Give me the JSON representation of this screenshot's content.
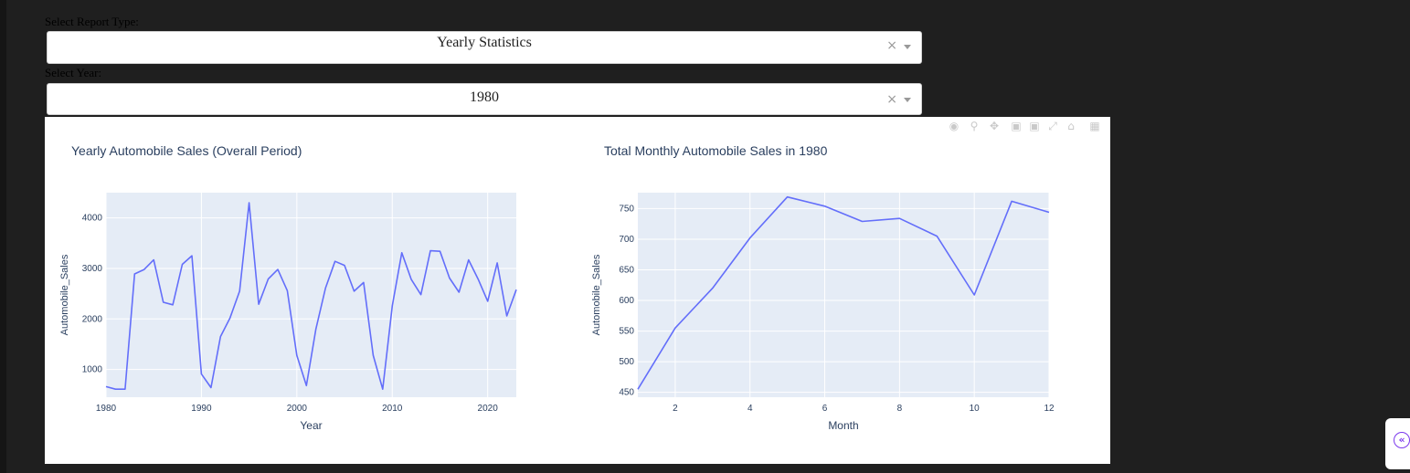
{
  "form": {
    "report_type_label": "Select Report Type:",
    "report_type_value": "Yearly Statistics",
    "year_label": "Select Year:",
    "year_value": "1980",
    "clear_glyph": "×"
  },
  "toolbar": {
    "icons": [
      "camera-icon",
      "zoom-icon",
      "pan-icon",
      "zoom-in-icon",
      "zoom-out-icon",
      "autoscale-icon",
      "reset-axes-icon",
      "plotly-logo-icon"
    ]
  },
  "colors": {
    "background": "#1f1f1f",
    "line": "#636efa",
    "plot_bg": "#e5ecf6",
    "text": "#2a3f5f"
  },
  "chart_data": [
    {
      "type": "line",
      "title": "Yearly Automobile Sales (Overall Period)",
      "xlabel": "Year",
      "ylabel": "Automobile_Sales",
      "xlim": [
        1980,
        2023
      ],
      "ylim": [
        450,
        4500
      ],
      "xticks": [
        1980,
        1990,
        2000,
        2010,
        2020
      ],
      "yticks": [
        1000,
        2000,
        3000,
        4000
      ],
      "grid": true,
      "x": [
        1980,
        1981,
        1982,
        1983,
        1984,
        1985,
        1986,
        1987,
        1988,
        1989,
        1990,
        1991,
        1992,
        1993,
        1994,
        1995,
        1996,
        1997,
        1998,
        1999,
        2000,
        2001,
        2002,
        2003,
        2004,
        2005,
        2006,
        2007,
        2008,
        2009,
        2010,
        2011,
        2012,
        2013,
        2014,
        2015,
        2016,
        2017,
        2018,
        2019,
        2020,
        2021,
        2022,
        2023
      ],
      "y": [
        660,
        610,
        610,
        2890,
        2980,
        3170,
        2330,
        2280,
        3080,
        3250,
        910,
        640,
        1650,
        2020,
        2550,
        4300,
        2290,
        2790,
        2980,
        2560,
        1280,
        680,
        1800,
        2610,
        3140,
        3060,
        2550,
        2720,
        1280,
        610,
        2260,
        3310,
        2780,
        2480,
        3350,
        3340,
        2810,
        2530,
        3170,
        2790,
        2350,
        3110,
        2060,
        2580
      ]
    },
    {
      "type": "line",
      "title": "Total Monthly Automobile Sales in 1980",
      "xlabel": "Month",
      "ylabel": "Automobile_Sales",
      "xlim": [
        1,
        12
      ],
      "ylim": [
        442,
        776
      ],
      "xticks": [
        2,
        4,
        6,
        8,
        10,
        12
      ],
      "yticks": [
        450,
        500,
        550,
        600,
        650,
        700,
        750
      ],
      "grid": true,
      "x": [
        1,
        2,
        3,
        4,
        5,
        6,
        7,
        8,
        9,
        10,
        11,
        12
      ],
      "y": [
        455,
        555,
        620,
        702,
        769,
        754,
        729,
        734,
        705,
        609,
        762,
        744
      ]
    }
  ]
}
